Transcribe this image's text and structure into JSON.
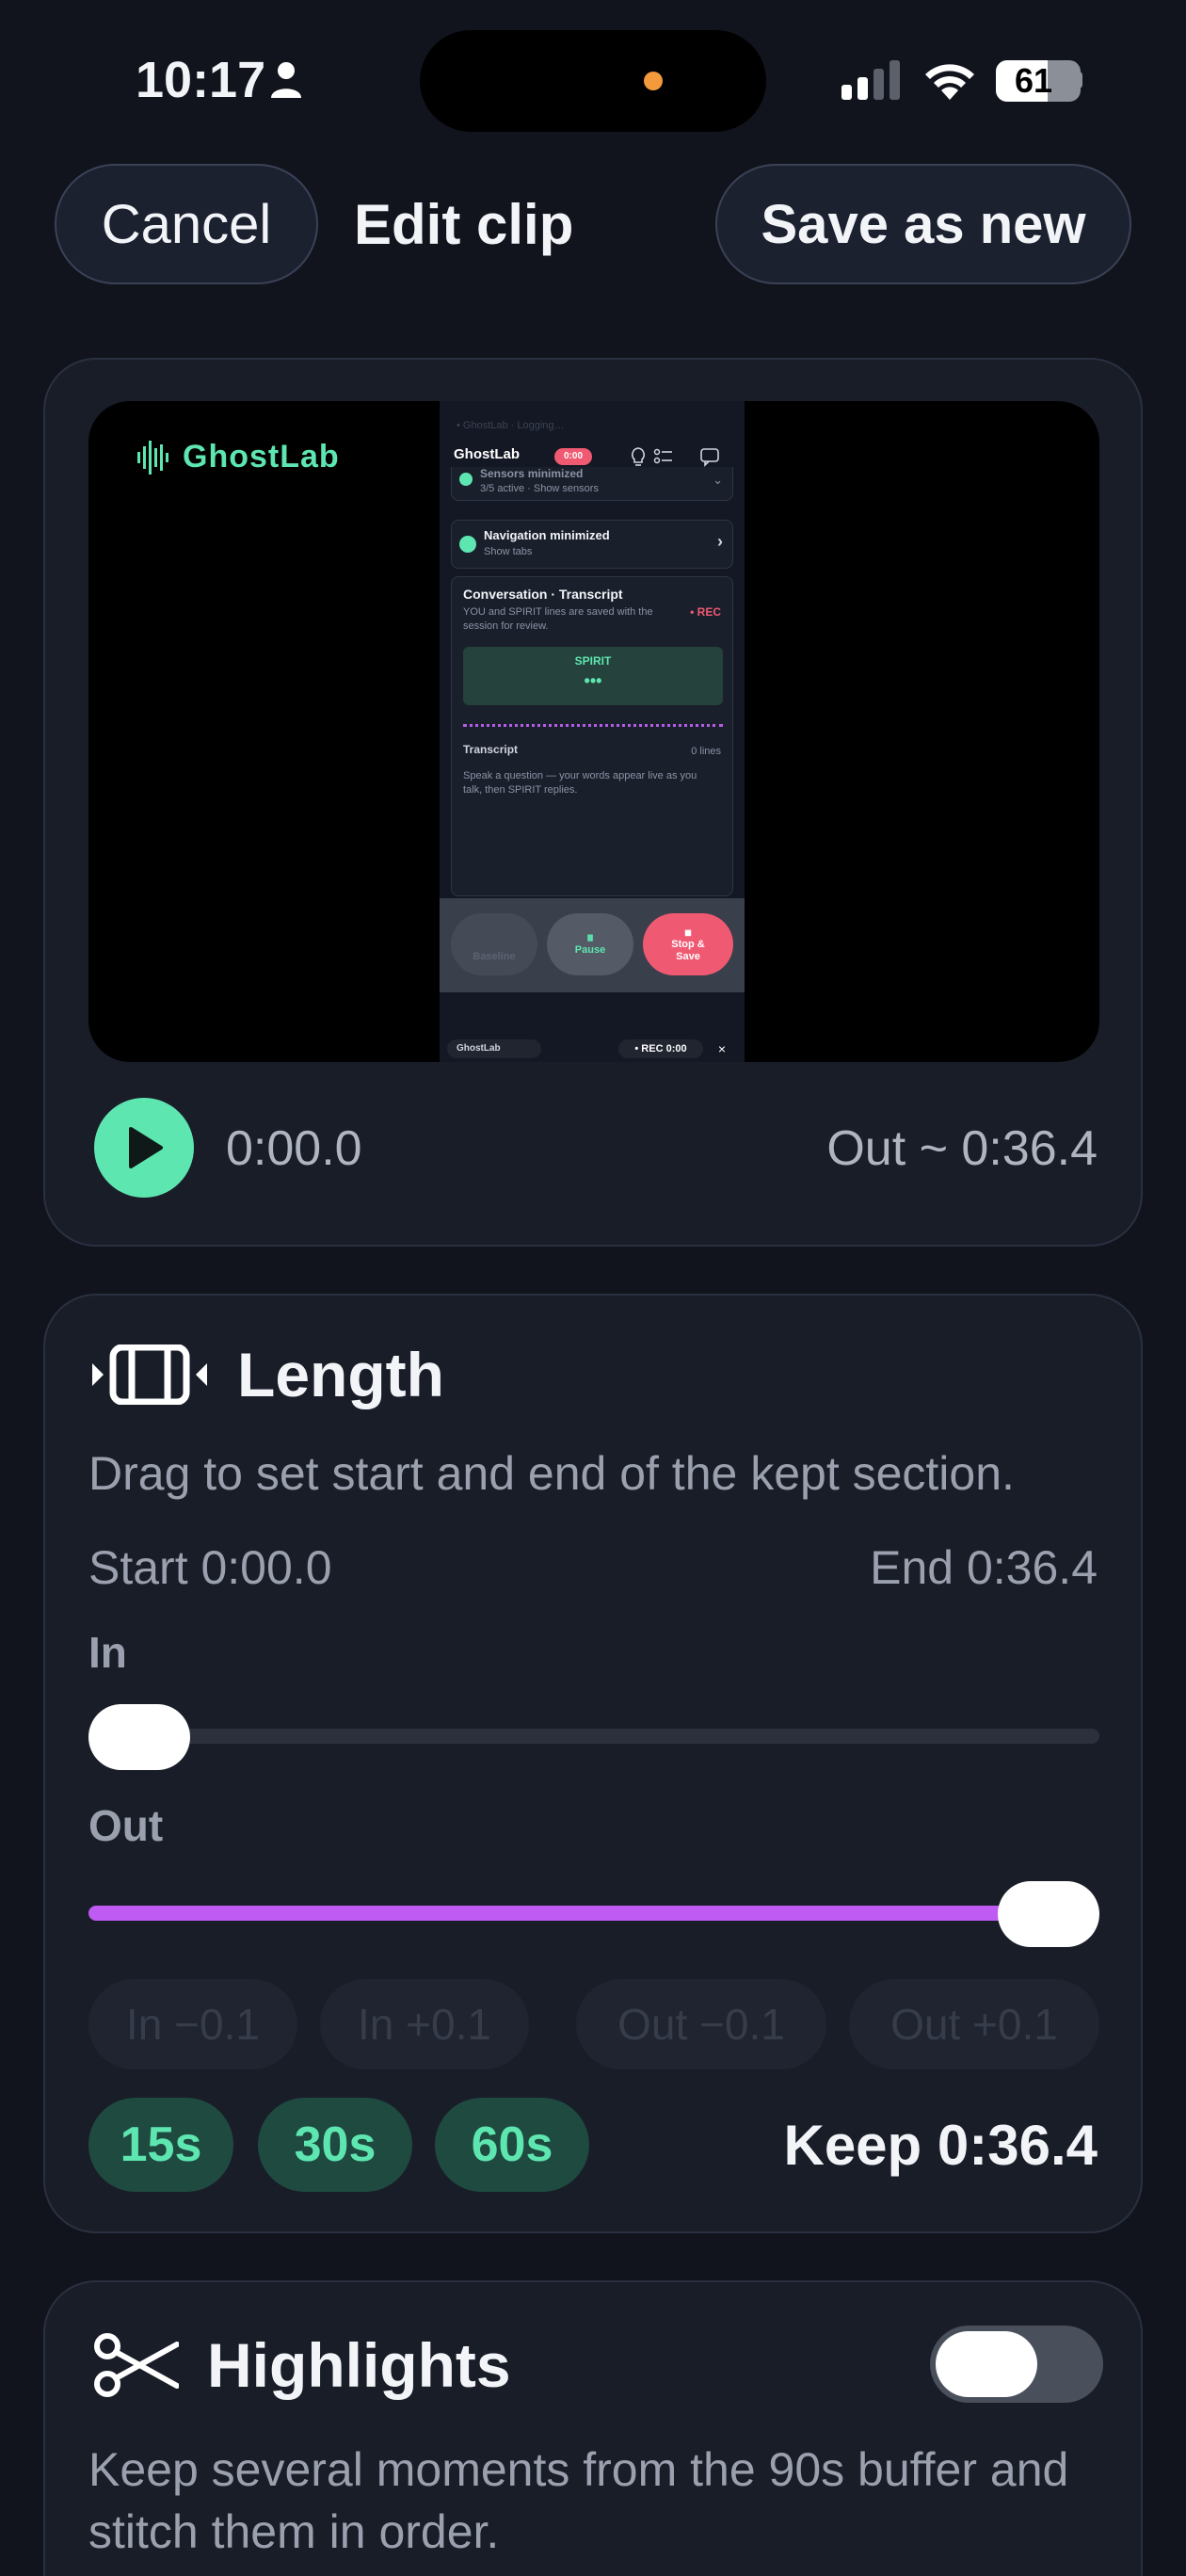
{
  "status_bar": {
    "time": "10:17",
    "battery": "61",
    "battery_level": 0.61
  },
  "header": {
    "cancel_label": "Cancel",
    "title": "Edit clip",
    "save_label": "Save as new"
  },
  "preview": {
    "brand": "GhostLab",
    "current_time": "0:00.0",
    "out_time": "Out ~ 0:36.4",
    "phone": {
      "faint_top": "• GhostLab · Logging…",
      "app_name": "GhostLab",
      "timer": "0:00",
      "sensors_title": "Sensors minimized",
      "sensors_sub": "3/5 active · Show sensors",
      "nav_title": "Navigation minimized",
      "nav_sub": "Show tabs",
      "conv_title": "Conversation · Transcript",
      "conv_desc": "YOU and SPIRIT lines are saved with the session for review.",
      "rec": "• REC",
      "spirit": "SPIRIT",
      "spirit_dots": "•••",
      "transcript": "Transcript",
      "lines": "0 lines",
      "hint": "Speak a question — your words appear live as you talk, then SPIRIT replies.",
      "baseline": "Baseline",
      "pause": "Pause",
      "stop_save": "Stop & Save",
      "mini_app": "GhostLab",
      "mini_rec": "• REC 0:00",
      "mini_close": "×"
    }
  },
  "length": {
    "title": "Length",
    "description": "Drag to set start and end of the kept section.",
    "start": "Start 0:00.0",
    "end": "End 0:36.4",
    "in_label": "In",
    "out_label": "Out",
    "in_fraction": 0.0,
    "out_fraction": 1.0,
    "nudges": [
      "In −0.1",
      "In +0.1",
      "Out −0.1",
      "Out +0.1"
    ],
    "presets": [
      "15s",
      "30s",
      "60s"
    ],
    "keep": "Keep 0:36.4"
  },
  "highlights": {
    "title": "Highlights",
    "description": "Keep several moments from the 90s buffer and stitch them in order.",
    "enabled": false
  },
  "colors": {
    "accent": "#5ee6b0",
    "range": "#bf5af2",
    "rec": "#ef5a72",
    "background": "#11141c"
  }
}
